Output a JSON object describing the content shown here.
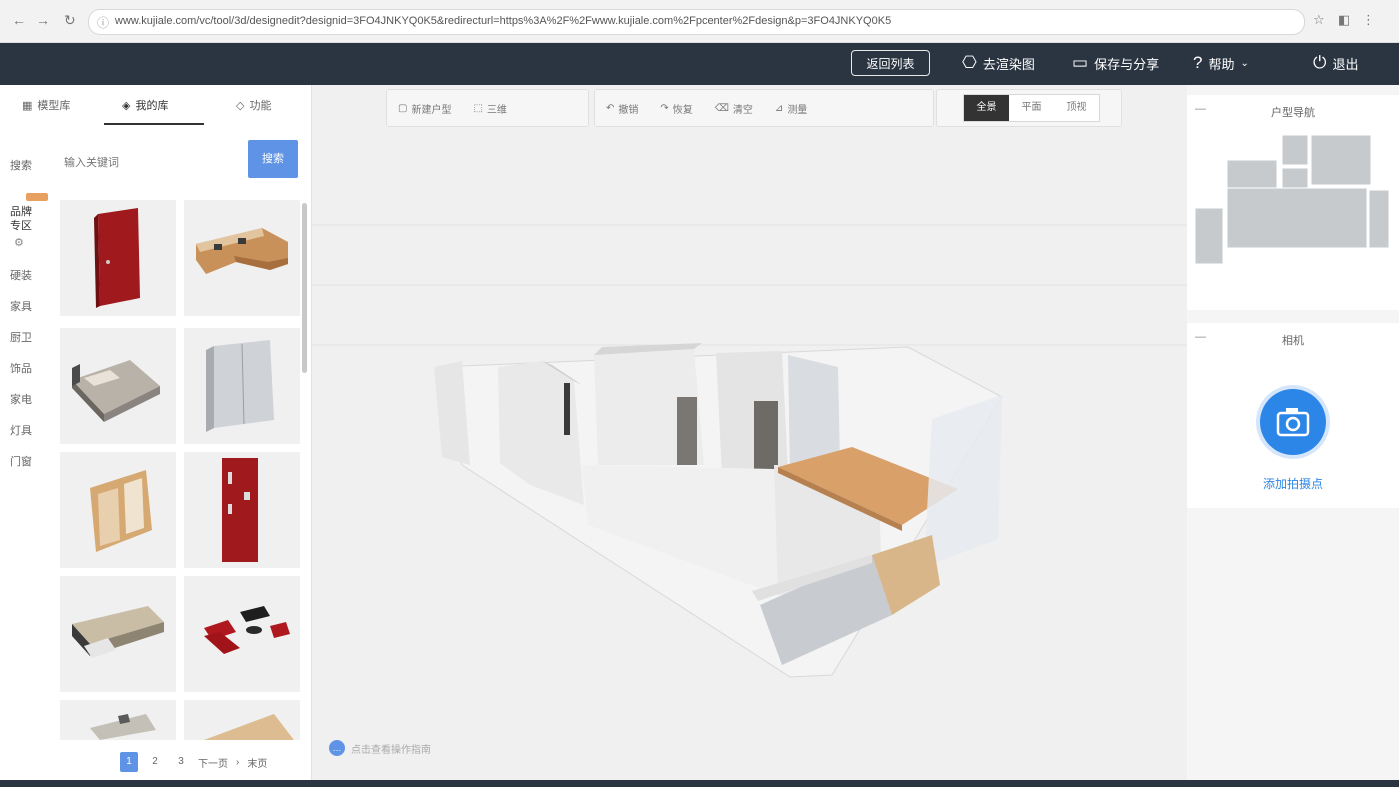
{
  "browser": {
    "back_icon": "back-arrow-icon",
    "reload_icon": "reload-icon",
    "url": "www.kujiale.com/vc/tool/3d/designedit?designid=3FO4JNKYQ0K5&redirecturl=https%3A%2F%2Fwww.kujiale.com%2Fpcenter%2Fdesign&p=3FO4JNKYQ0K5"
  },
  "topbar": {
    "return_label": "返回列表",
    "render_label": "去渲染图",
    "save_label": "保存与分享",
    "help_label": "帮助",
    "exit_label": "退出"
  },
  "left": {
    "tabs": [
      {
        "label": "模型库",
        "icon": "library-icon"
      },
      {
        "label": "我的库",
        "icon": "my-library-icon"
      },
      {
        "label": "功能",
        "icon": "function-icon"
      }
    ],
    "search_label": "搜索",
    "search_placeholder": "输入关键词",
    "search_button": "搜索",
    "categories": [
      "品牌专区",
      "硬装",
      "家具",
      "厨卫",
      "饰品",
      "家电",
      "灯具",
      "门窗"
    ],
    "pager": {
      "pages": [
        "1",
        "2",
        "3"
      ],
      "next": "下一页",
      "last": "末页"
    }
  },
  "viewport": {
    "tools_a": [
      "新建户型",
      "三维"
    ],
    "tools_b": [
      "撤销",
      "恢复",
      "清空",
      "测量"
    ],
    "view_modes": [
      "全景",
      "平面",
      "顶视"
    ],
    "active_view": "全景",
    "hint": "点击查看操作指南"
  },
  "right": {
    "minimap_title": "户型导航",
    "camera_card_title": "相机",
    "camera_label": "添加拍摄点"
  },
  "colors": {
    "topbar": "#2b3542",
    "accent": "#5f93e6",
    "camera": "#2c86e8"
  }
}
